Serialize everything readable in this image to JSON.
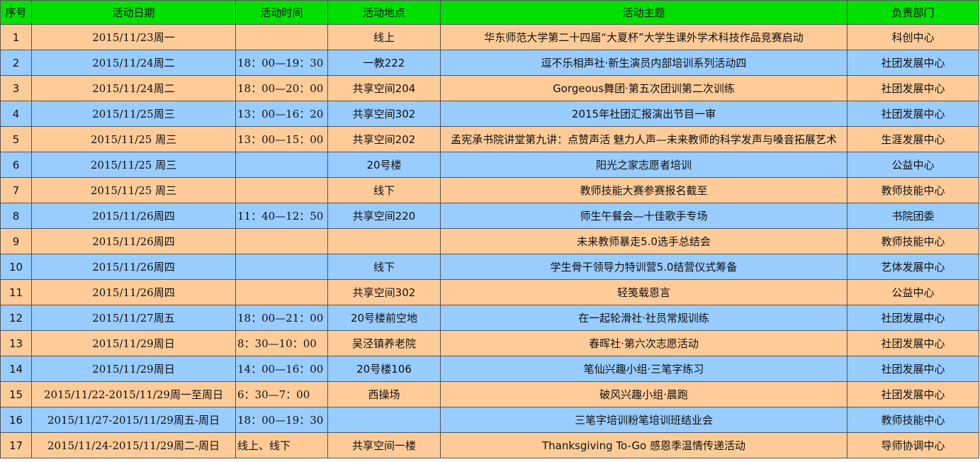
{
  "header": {
    "col_index": "序号",
    "col_date": "活动日期",
    "col_time": "活动时间",
    "col_place": "活动地点",
    "col_topic": "活动主题",
    "col_dept": "负责部门"
  },
  "colors": {
    "header_bg": "#00e100",
    "row_orange": "#ffcc99",
    "row_blue": "#99ccff",
    "grid_line": "#555555"
  },
  "rows": [
    {
      "index": "1",
      "date": "2015/11/23周一",
      "time": "",
      "place": "线上",
      "topic": "华东师范大学第二十四届“大夏杯”大学生课外学术科技作品竞赛启动",
      "dept": "科创中心"
    },
    {
      "index": "2",
      "date": "2015/11/24周二",
      "time": "18：00—19：30",
      "place": "一教222",
      "topic": "逗不乐相声社·新生演员内部培训系列活动四",
      "dept": "社团发展中心"
    },
    {
      "index": "3",
      "date": "2015/11/24周二",
      "time": "18：00—20：00",
      "place": "共享空间204",
      "topic": "Gorgeous舞团·第五次团训第二次训练",
      "dept": "社团发展中心"
    },
    {
      "index": "4",
      "date": "2015/11/25周三",
      "time": "13：00—16：20",
      "place": "共享空间302",
      "topic": "2015年社团汇报演出节目一审",
      "dept": "社团发展中心"
    },
    {
      "index": "5",
      "date": "2015/11/25 周三",
      "time": "13：00—15：00",
      "place": "共享空间202",
      "topic": "孟宪承书院讲堂第九讲：点赞声活 魅力人声—未来教师的科学发声与嗓音拓展艺术",
      "dept": "生涯发展中心"
    },
    {
      "index": "6",
      "date": "2015/11/25 周三",
      "time": "",
      "place": "20号楼",
      "topic": "阳光之家志愿者培训",
      "dept": "公益中心"
    },
    {
      "index": "7",
      "date": "2015/11/25 周三",
      "time": "",
      "place": "线下",
      "topic": "教师技能大赛参赛报名截至",
      "dept": "教师技能中心"
    },
    {
      "index": "8",
      "date": "2015/11/26周四",
      "time": "11：40—12：50",
      "place": "共享空间220",
      "topic": "师生午餐会—十佳歌手专场",
      "dept": "书院团委"
    },
    {
      "index": "9",
      "date": "2015/11/26周四",
      "time": "",
      "place": "",
      "topic": "未来教师暴走5.0选手总结会",
      "dept": "教师技能中心"
    },
    {
      "index": "10",
      "date": "2015/11/26周四",
      "time": "",
      "place": "线下",
      "topic": "学生骨干领导力特训营5.0结营仪式筹备",
      "dept": "艺体发展中心"
    },
    {
      "index": "11",
      "date": "2015/11/26周四",
      "time": "",
      "place": "共享空间302",
      "topic": "轻笺载恩言",
      "dept": "公益中心"
    },
    {
      "index": "12",
      "date": "2015/11/27周五",
      "time": "18：00—21：00",
      "place": "20号楼前空地",
      "topic": "在一起轮滑社·社员常规训练",
      "dept": "社团发展中心"
    },
    {
      "index": "13",
      "date": "2015/11/29周日",
      "time": "8：30—10：00",
      "place": "吴泾镇养老院",
      "topic": "春晖社·第六次志愿活动",
      "dept": "社团发展中心"
    },
    {
      "index": "14",
      "date": "2015/11/29周日",
      "time": "14：00—16：00",
      "place": "20号楼106",
      "topic": "笔仙兴趣小组·三笔字练习",
      "dept": "社团发展中心"
    },
    {
      "index": "15",
      "date": "2015/11/22-2015/11/29周一至周日",
      "time": "6：30—7：00",
      "place": "西操场",
      "topic": "破风兴趣小组·晨跑",
      "dept": "社团发展中心"
    },
    {
      "index": "16",
      "date": "2015/11/27-2015/11/29周五-周日",
      "time": "18：00—19：30",
      "place": "",
      "topic": "三笔字培训粉笔培训班结业会",
      "dept": "教师技能中心"
    },
    {
      "index": "17",
      "date": "2015/11/24-2015/11/29周二-周日",
      "time": "线上、线下",
      "place": "共享空间一楼",
      "topic": "Thanksgiving To-Go 感恩季温情传递活动",
      "dept": "导师协调中心"
    }
  ]
}
